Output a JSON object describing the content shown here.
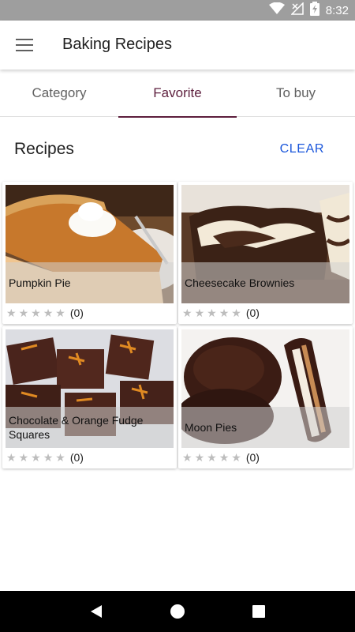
{
  "status_bar": {
    "time": "8:32",
    "icons": [
      "wifi-icon",
      "no-signal-icon",
      "battery-charging-icon"
    ]
  },
  "app_bar": {
    "title": "Baking Recipes",
    "menu_icon": "hamburger-menu-icon"
  },
  "tabs": [
    {
      "label": "Category",
      "active": false
    },
    {
      "label": "Favorite",
      "active": true
    },
    {
      "label": "To buy",
      "active": false
    }
  ],
  "section": {
    "title": "Recipes",
    "clear_label": "CLEAR"
  },
  "recipes": [
    {
      "name": "Pumpkin Pie",
      "rating": 0,
      "rating_count": "(0)"
    },
    {
      "name": "Cheesecake Brownies",
      "rating": 0,
      "rating_count": "(0)"
    },
    {
      "name": "Chocolate & Orange Fudge Squares",
      "rating": 0,
      "rating_count": "(0)"
    },
    {
      "name": "Moon Pies",
      "rating": 0,
      "rating_count": "(0)"
    }
  ],
  "colors": {
    "accent": "#5d1f3d",
    "clear_button": "#1a56db",
    "status_bar": "#9e9e9e",
    "star_empty": "#bdbdbd"
  },
  "nav_bar": {
    "icons": [
      "back-icon",
      "home-icon",
      "recents-icon"
    ]
  }
}
